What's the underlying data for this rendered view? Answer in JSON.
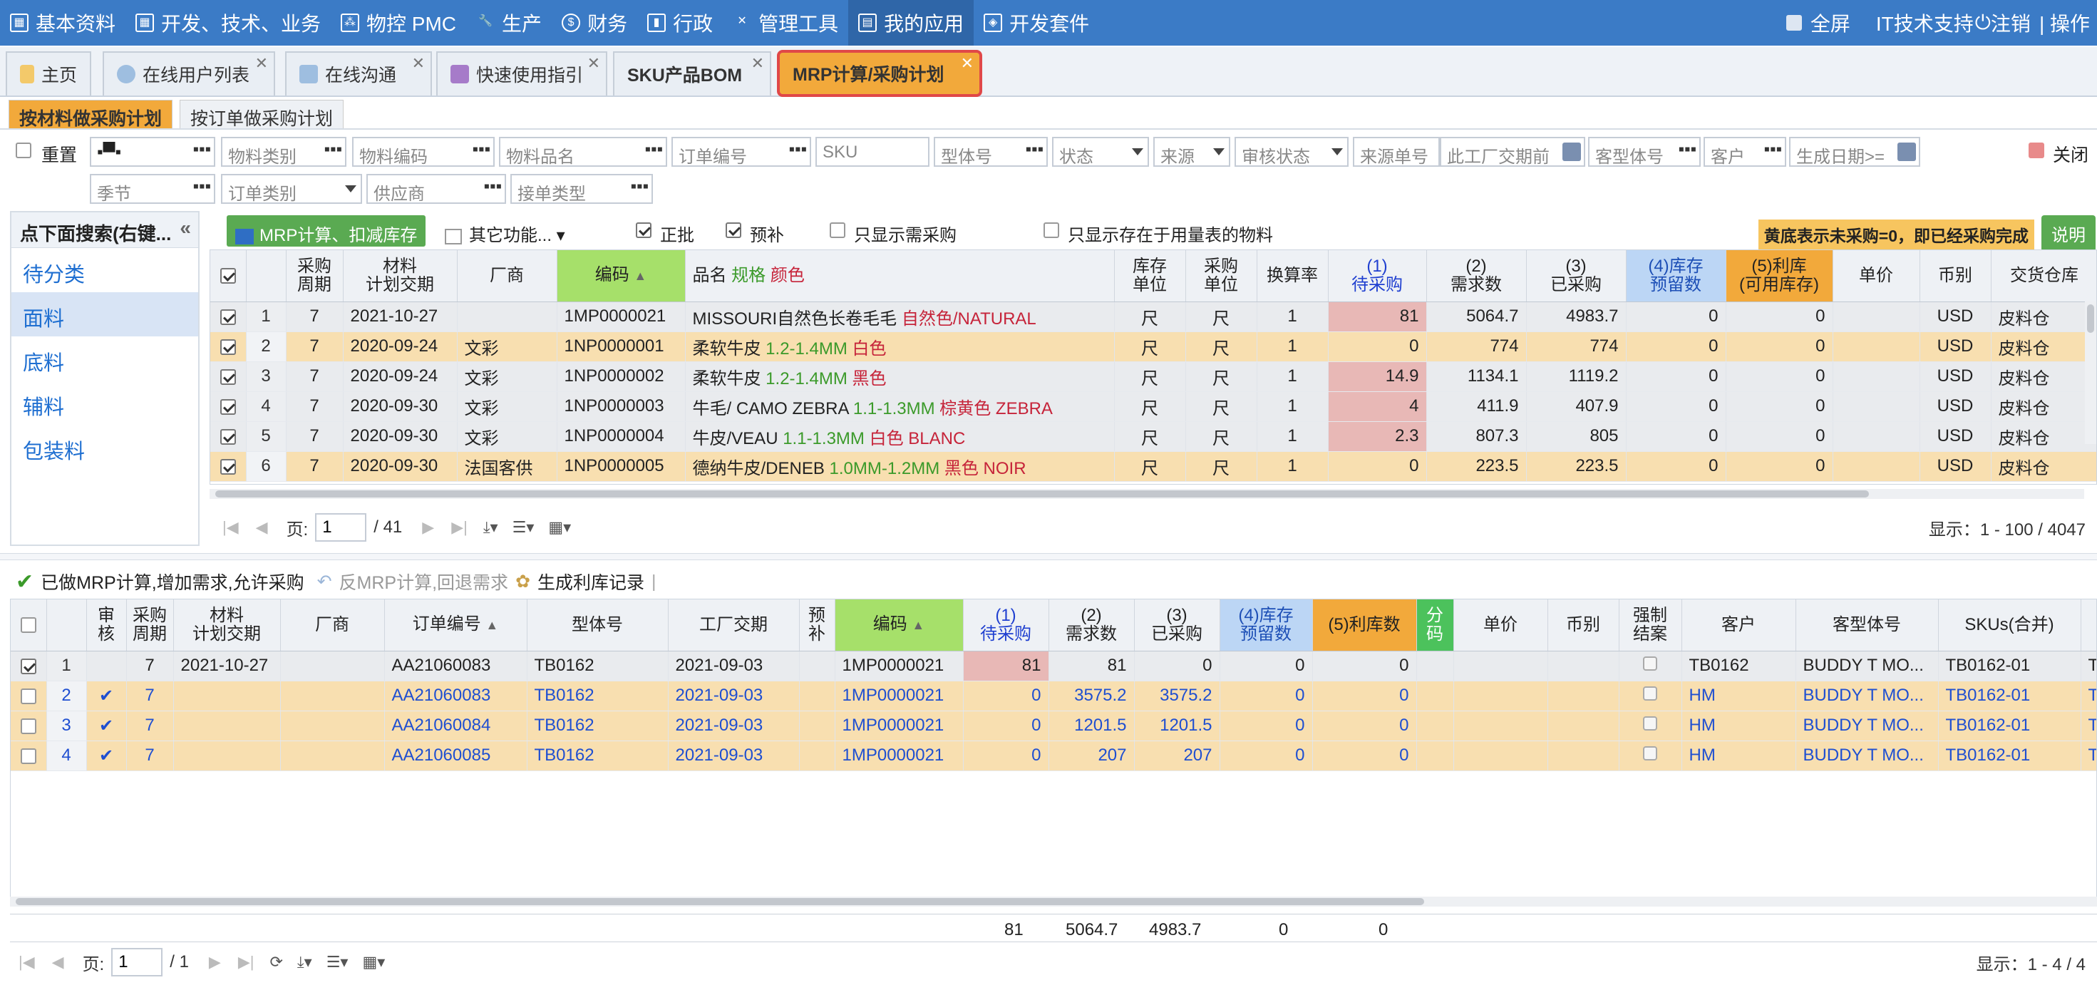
{
  "topnav": {
    "items": [
      "基本资料",
      "开发、技术、业务",
      "物控 PMC",
      "生产",
      "财务",
      "行政",
      "管理工具",
      "我的应用",
      "开发套件"
    ],
    "fullscreen": "全屏",
    "user": "IT技术支持",
    "logout": "注销",
    "ops": "| 操作"
  },
  "tabs": [
    "主页",
    "在线用户列表",
    "在线沟通",
    "快速使用指引",
    "SKU产品BOM",
    "MRP计算/采购计划"
  ],
  "subtabs": [
    "按材料做采购计划",
    "按订单做采购计划"
  ],
  "filters": {
    "reset": "重置",
    "row1": [
      "物料类别",
      "物料编码",
      "物料品名",
      "订单编号",
      "SKU",
      "型体号",
      "状态",
      "来源",
      "审核状态",
      "来源单号",
      "此工厂交期前",
      "客型体号",
      "客户",
      "生成日期>="
    ],
    "row2": [
      "季节",
      "订单类别",
      "供应商",
      "接单类型"
    ],
    "close": "关闭"
  },
  "left": {
    "header": "点下面搜索(右键...",
    "items": [
      "待分类",
      "面料",
      "底料",
      "辅料",
      "包装料"
    ]
  },
  "toolbar1": {
    "mrp_btn": "MRP计算、扣减库存",
    "other": "其它功能...",
    "zhengpi": "正批",
    "yubu": "预补",
    "only_need": "只显示需采购",
    "only_exist": "只显示存在于用量表的物料",
    "notice": "黄底表示未采购=0，即已经采购完成",
    "explain": "说明"
  },
  "grid1": {
    "headers": {
      "cycle": "采购\n周期",
      "plan_date": "材料\n计划交期",
      "vendor": "厂商",
      "code": "编码",
      "name_a": "品名",
      "name_b": "规格",
      "name_c": "颜色",
      "stock_unit": "库存\n单位",
      "buy_unit": "采购\n单位",
      "rate": "换算率",
      "h1": "(1)\n待采购",
      "h2": "(2)\n需求数",
      "h3": "(3)\n已采购",
      "h4": "(4)库存\n预留数",
      "h5": "(5)利库\n(可用库存)",
      "price": "单价",
      "currency": "币别",
      "warehouse": "交货仓库"
    },
    "rows": [
      {
        "n": "1",
        "cycle": "7",
        "date": "2021-10-27",
        "vendor": "",
        "code": "1MP0000021",
        "name": "MISSOURI自然色长卷毛毛",
        "spec": "",
        "color": "自然色/NATURAL",
        "su": "尺",
        "bu": "尺",
        "rate": "1",
        "q1": "81",
        "q2": "5064.7",
        "q3": "4983.7",
        "q4": "0",
        "q5": "0",
        "cur": "USD",
        "wh": "皮料仓",
        "style": "grey",
        "pink": true
      },
      {
        "n": "2",
        "cycle": "7",
        "date": "2020-09-24",
        "vendor": "文彩",
        "code": "1NP0000001",
        "name": "柔软牛皮",
        "spec": "1.2-1.4MM",
        "color": "白色",
        "su": "尺",
        "bu": "尺",
        "rate": "1",
        "q1": "0",
        "q2": "774",
        "q3": "774",
        "q4": "0",
        "q5": "0",
        "cur": "USD",
        "wh": "皮料仓",
        "style": "orange",
        "pink": false
      },
      {
        "n": "3",
        "cycle": "7",
        "date": "2020-09-24",
        "vendor": "文彩",
        "code": "1NP0000002",
        "name": "柔软牛皮",
        "spec": "1.2-1.4MM",
        "color": "黑色",
        "su": "尺",
        "bu": "尺",
        "rate": "1",
        "q1": "14.9",
        "q2": "1134.1",
        "q3": "1119.2",
        "q4": "0",
        "q5": "0",
        "cur": "USD",
        "wh": "皮料仓",
        "style": "grey",
        "pink": true
      },
      {
        "n": "4",
        "cycle": "7",
        "date": "2020-09-30",
        "vendor": "文彩",
        "code": "1NP0000003",
        "name": "牛毛/ CAMO ZEBRA",
        "spec": "1.1-1.3MM",
        "color": "棕黄色 ZEBRA",
        "su": "尺",
        "bu": "尺",
        "rate": "1",
        "q1": "4",
        "q2": "411.9",
        "q3": "407.9",
        "q4": "0",
        "q5": "0",
        "cur": "USD",
        "wh": "皮料仓",
        "style": "grey",
        "pink": true
      },
      {
        "n": "5",
        "cycle": "7",
        "date": "2020-09-30",
        "vendor": "文彩",
        "code": "1NP0000004",
        "name": "牛皮/VEAU",
        "spec": "1.1-1.3MM",
        "color": "白色 BLANC",
        "su": "尺",
        "bu": "尺",
        "rate": "1",
        "q1": "2.3",
        "q2": "807.3",
        "q3": "805",
        "q4": "0",
        "q5": "0",
        "cur": "USD",
        "wh": "皮料仓",
        "style": "grey",
        "pink": true
      },
      {
        "n": "6",
        "cycle": "7",
        "date": "2020-09-30",
        "vendor": "法国客供",
        "code": "1NP0000005",
        "name": "德纳牛皮/DENEB",
        "spec": "1.0MM-1.2MM",
        "color": "黑色 NOIR",
        "su": "尺",
        "bu": "尺",
        "rate": "1",
        "q1": "0",
        "q2": "223.5",
        "q3": "223.5",
        "q4": "0",
        "q5": "0",
        "cur": "USD",
        "wh": "皮料仓",
        "style": "orange",
        "pink": false
      }
    ]
  },
  "pager1": {
    "page_label": "页:",
    "page": "1",
    "total": "/ 41",
    "display": "显示：1 - 100 / 4047"
  },
  "toolbar2": {
    "done": "已做MRP计算,增加需求,允许采购",
    "undo": "反MRP计算,回退需求",
    "gen": "生成利库记录"
  },
  "grid2": {
    "headers": {
      "audit": "审\n核",
      "cycle": "采购\n周期",
      "plan_date": "材料\n计划交期",
      "vendor": "厂商",
      "order": "订单编号",
      "model": "型体号",
      "factory_date": "工厂交期",
      "yubu": "预\n补",
      "code": "编码",
      "h1": "(1)\n待采购",
      "h2": "(2)\n需求数",
      "h3": "(3)\n已采购",
      "h4": "(4)库存\n预留数",
      "h5": "(5)利库数",
      "fen": "分\n码",
      "price": "单价",
      "currency": "币别",
      "force": "强制\n结案",
      "customer": "客户",
      "cust_model": "客型体号",
      "skus": "SKUs(合并)"
    },
    "rows": [
      {
        "n": "1",
        "audit": "",
        "cycle": "7",
        "date": "2021-10-27",
        "vendor": "",
        "order": "AA21060083",
        "model": "TB0162",
        "fdate": "2021-09-03",
        "code": "1MP0000021",
        "q1": "81",
        "q2": "81",
        "q3": "0",
        "q4": "0",
        "q5": "0",
        "cust": "TB0162",
        "cmodel": "BUDDY T MO...",
        "sku": "TB0162-01",
        "extra": "TOF",
        "style": "grey",
        "pink": true
      },
      {
        "n": "2",
        "audit": "✔",
        "cycle": "7",
        "date": "",
        "order": "AA21060083",
        "model": "TB0162",
        "fdate": "2021-09-03",
        "code": "1MP0000021",
        "q1": "0",
        "q2": "3575.2",
        "q3": "3575.2",
        "q4": "0",
        "q5": "0",
        "cust": "HM",
        "cmodel": "BUDDY T MO...",
        "sku": "TB0162-01",
        "extra": "TOF",
        "style": "orange blue",
        "pink": false
      },
      {
        "n": "3",
        "audit": "✔",
        "cycle": "7",
        "date": "",
        "order": "AA21060084",
        "model": "TB0162",
        "fdate": "2021-09-03",
        "code": "1MP0000021",
        "q1": "0",
        "q2": "1201.5",
        "q3": "1201.5",
        "q4": "0",
        "q5": "0",
        "cust": "HM",
        "cmodel": "BUDDY T MO...",
        "sku": "TB0162-01",
        "extra": "TOF",
        "style": "orange blue",
        "pink": false
      },
      {
        "n": "4",
        "audit": "✔",
        "cycle": "7",
        "date": "",
        "order": "AA21060085",
        "model": "TB0162",
        "fdate": "2021-09-03",
        "code": "1MP0000021",
        "q1": "0",
        "q2": "207",
        "q3": "207",
        "q4": "0",
        "q5": "0",
        "cust": "HM",
        "cmodel": "BUDDY T MO...",
        "sku": "TB0162-01",
        "extra": "TOF",
        "style": "orange blue",
        "pink": false
      }
    ]
  },
  "summary": {
    "q1": "81",
    "q2": "5064.7",
    "q3": "4983.7",
    "q4": "0",
    "q5": "0"
  },
  "pager2": {
    "page_label": "页:",
    "page": "1",
    "total": "/ 1",
    "display": "显示：1 - 4 / 4"
  },
  "colors": {
    "nav": "#3b7bc6",
    "accent_orange": "#f2a93b",
    "green": "#5aaa52",
    "pink": "#e8b8b6",
    "row_orange": "#f8dfb0"
  }
}
